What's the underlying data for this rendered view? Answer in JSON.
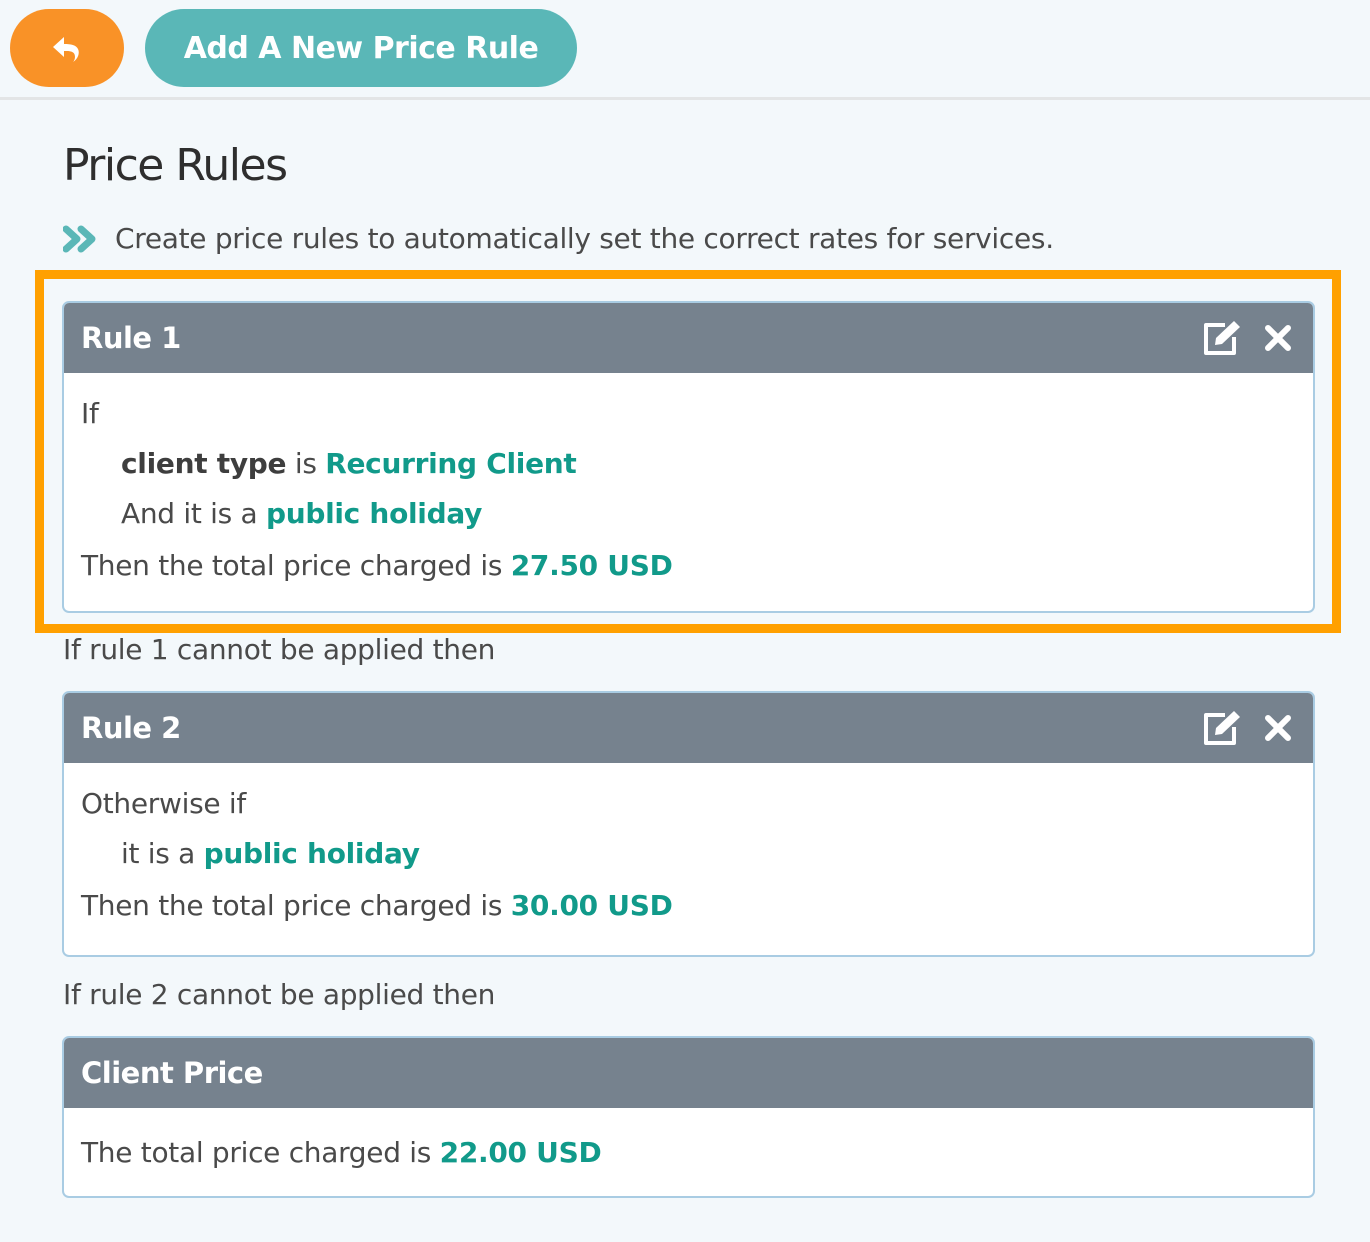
{
  "toolbar": {
    "back_icon": "reply-arrow-icon",
    "add_button_label": "Add A New Price Rule"
  },
  "page": {
    "title": "Price Rules",
    "intro_icon": "double-chevron-right-icon",
    "intro_text": "Create price rules to automatically set the correct rates for services."
  },
  "colors": {
    "accent_orange": "#f99227",
    "accent_teal": "#5ab7b7",
    "highlight_box": "#ffa000",
    "value_green": "#119a8a",
    "card_header": "#76828e"
  },
  "rules": [
    {
      "title": "Rule 1",
      "edit_icon": "edit-icon",
      "delete_icon": "close-icon",
      "lead": "If",
      "conditions": [
        {
          "prefix": "",
          "field": "client type",
          "op": " is ",
          "value": "Recurring Client"
        },
        {
          "prefix": "And it is a ",
          "field": "",
          "op": "",
          "value": "public holiday"
        }
      ],
      "result_text": "Then the total price charged is ",
      "result_value": "27.50 USD"
    },
    {
      "title": "Rule 2",
      "edit_icon": "edit-icon",
      "delete_icon": "close-icon",
      "lead": "Otherwise if",
      "conditions": [
        {
          "prefix": "it is a ",
          "field": "",
          "op": "",
          "value": "public holiday"
        }
      ],
      "result_text": "Then the total price charged is ",
      "result_value": "30.00 USD"
    }
  ],
  "connectors": [
    "If rule 1 cannot be applied then",
    "If rule 2 cannot be applied then"
  ],
  "default_price": {
    "title": "Client Price",
    "text": "The total price charged is ",
    "value": "22.00 USD"
  }
}
